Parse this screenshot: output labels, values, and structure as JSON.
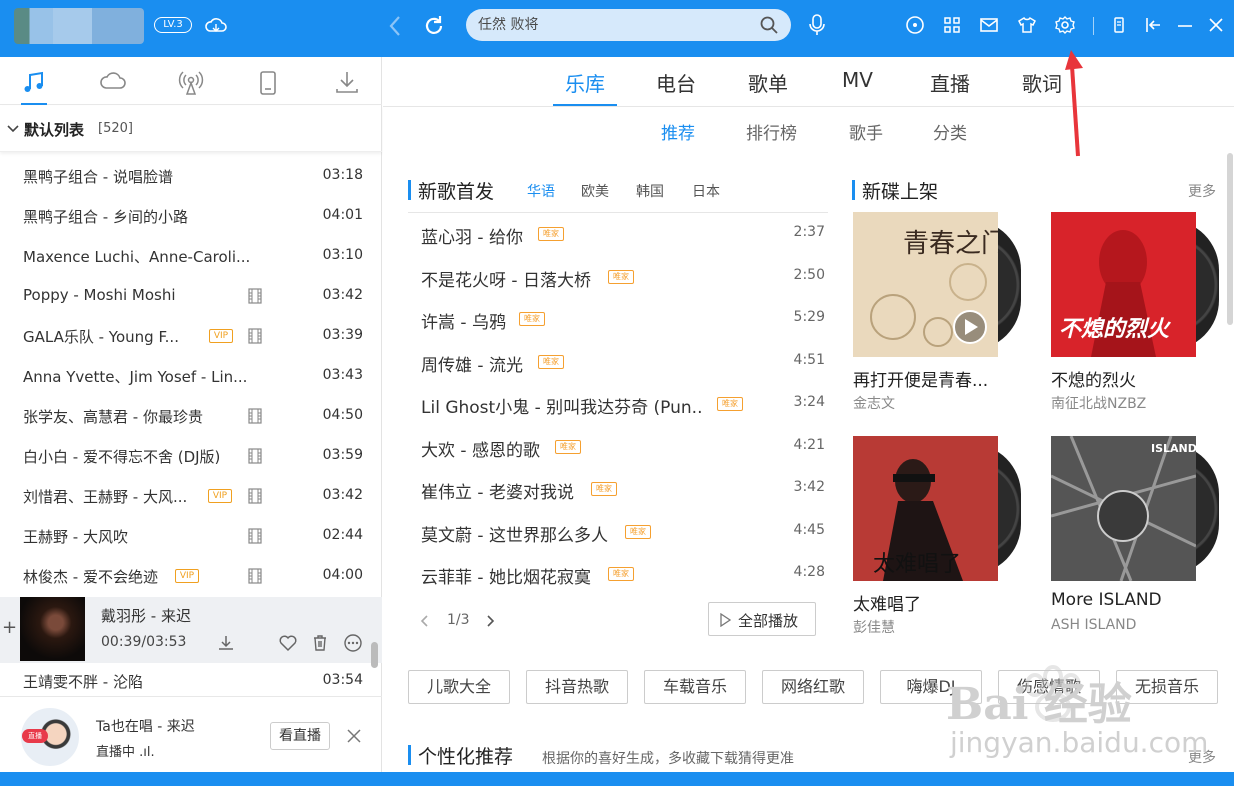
{
  "header": {
    "level": "LV.3",
    "search_placeholder": "任然 败将"
  },
  "sidebar": {
    "list_name": "默认列表",
    "list_count": "[520]",
    "songs": [
      {
        "title": "黑鸭子组合 - 说唱脸谱",
        "duration": "03:18",
        "vip": false,
        "mv": false
      },
      {
        "title": "黑鸭子组合 - 乡间的小路",
        "duration": "04:01",
        "vip": false,
        "mv": false
      },
      {
        "title": "Maxence Luchi、Anne-Caroli...",
        "duration": "03:10",
        "vip": false,
        "mv": false
      },
      {
        "title": "Poppy - Moshi Moshi",
        "duration": "03:42",
        "vip": false,
        "mv": true
      },
      {
        "title": "GALA乐队 - Young F...",
        "duration": "03:39",
        "vip": true,
        "mv": true
      },
      {
        "title": "Anna Yvette、Jim Yosef - Lin...",
        "duration": "03:43",
        "vip": false,
        "mv": false
      },
      {
        "title": "张学友、高慧君 - 你最珍贵",
        "duration": "04:50",
        "vip": false,
        "mv": true
      },
      {
        "title": "白小白 - 爱不得忘不舍 (DJ版)",
        "duration": "03:59",
        "vip": false,
        "mv": true
      },
      {
        "title": "刘惜君、王赫野 - 大风...",
        "duration": "03:42",
        "vip": true,
        "mv": true
      },
      {
        "title": "王赫野 - 大风吹",
        "duration": "02:44",
        "vip": false,
        "mv": true
      },
      {
        "title": "林俊杰 - 爱不会绝迹",
        "duration": "04:00",
        "vip": true,
        "mv": true
      }
    ],
    "vip_label": "VIP",
    "now_playing": {
      "title": "戴羽彤 - 来迟",
      "time": "00:39/03:53",
      "plus": "+"
    },
    "after_song": {
      "title": "王靖雯不胖 - 沦陷",
      "duration": "03:54"
    },
    "live": {
      "badge": "直播",
      "text": "Ta也在唱 - 来迟",
      "sub": "直播中 .ıl.",
      "button": "看直播"
    }
  },
  "main": {
    "tabs": [
      "乐库",
      "电台",
      "歌单",
      "MV",
      "直播",
      "歌词"
    ],
    "subtabs": [
      "推荐",
      "排行榜",
      "歌手",
      "分类"
    ],
    "new_songs": {
      "title": "新歌首发",
      "regions": [
        "华语",
        "欧美",
        "韩国",
        "日本"
      ],
      "tag": "唯家",
      "items": [
        {
          "title": "蓝心羽 - 给你",
          "duration": "2:37"
        },
        {
          "title": "不是花火呀 - 日落大桥",
          "duration": "2:50"
        },
        {
          "title": "许嵩 - 乌鸦",
          "duration": "5:29"
        },
        {
          "title": "周传雄 - 流光",
          "duration": "4:51"
        },
        {
          "title": "Lil Ghost小鬼 - 别叫我达芬奇 (Pun..",
          "duration": "3:24"
        },
        {
          "title": "大欢 - 感恩的歌",
          "duration": "4:21"
        },
        {
          "title": "崔伟立 - 老婆对我说",
          "duration": "3:42"
        },
        {
          "title": "莫文蔚 - 这世界那么多人",
          "duration": "4:45"
        },
        {
          "title": "云菲菲 - 她比烟花寂寞",
          "duration": "4:28"
        }
      ],
      "page": "1/3",
      "play_all": "全部播放"
    },
    "new_albums": {
      "title": "新碟上架",
      "more": "更多",
      "items": [
        {
          "title": "再打开便是青春...",
          "artist": "金志文",
          "art_text": "青春之门"
        },
        {
          "title": "不熄的烈火",
          "artist": "南征北战NZBZ",
          "art_text": "不熄的烈火"
        },
        {
          "title": "太难唱了",
          "artist": "彭佳慧",
          "art_text": "太难唱了"
        },
        {
          "title": "More ISLAND",
          "artist": "ASH ISLAND",
          "art_text": "ISLAND"
        }
      ]
    },
    "tags": [
      "儿歌大全",
      "抖音热歌",
      "车载音乐",
      "网络红歌",
      "嗨爆DJ",
      "伤感情歌",
      "无损音乐"
    ],
    "personal": {
      "title": "个性化推荐",
      "sub": "根据你的喜好生成，多收藏下载猜得更准",
      "more": "更多"
    }
  },
  "watermark": {
    "text": "Bai 经验",
    "sub": "jingyan.baidu.com"
  },
  "colors": {
    "accent": "#1a8ef0",
    "vip": "#f0a020",
    "arrow": "#e8353b"
  }
}
